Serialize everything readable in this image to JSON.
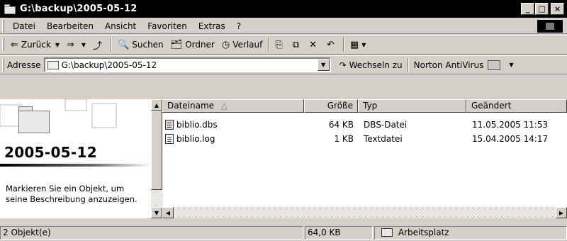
{
  "window": {
    "title": "G:\\backup\\2005-05-12",
    "buttons": {
      "minimize": "_",
      "maximize": "□",
      "close": "×"
    }
  },
  "menu": [
    "Datei",
    "Bearbeiten",
    "Ansicht",
    "Favoriten",
    "Extras",
    "?"
  ],
  "toolbar": {
    "back": "Zurück",
    "search": "Suchen",
    "folders": "Ordner",
    "history": "Verlauf"
  },
  "address": {
    "label": "Adresse",
    "value": "G:\\backup\\2005-05-12",
    "go": "Wechseln zu",
    "norton": "Norton AntiVirus"
  },
  "leftpane": {
    "folder_title": "2005-05-12",
    "description": "Markieren Sie ein Objekt, um seine Beschreibung anzuzeigen."
  },
  "columns": [
    "Dateiname",
    "Größe",
    "Typ",
    "Geändert"
  ],
  "files": [
    {
      "name": "biblio.dbs",
      "size": "64 KB",
      "type": "DBS-Datei",
      "modified": "11.05.2005 11:53",
      "icon": "dbs-file-icon"
    },
    {
      "name": "biblio.log",
      "size": "1 KB",
      "type": "Textdatei",
      "modified": "15.04.2005 14:17",
      "icon": "text-file-icon"
    }
  ],
  "status": {
    "count": "2 Objekt(e)",
    "size": "64,0 KB",
    "zone": "Arbeitsplatz"
  }
}
